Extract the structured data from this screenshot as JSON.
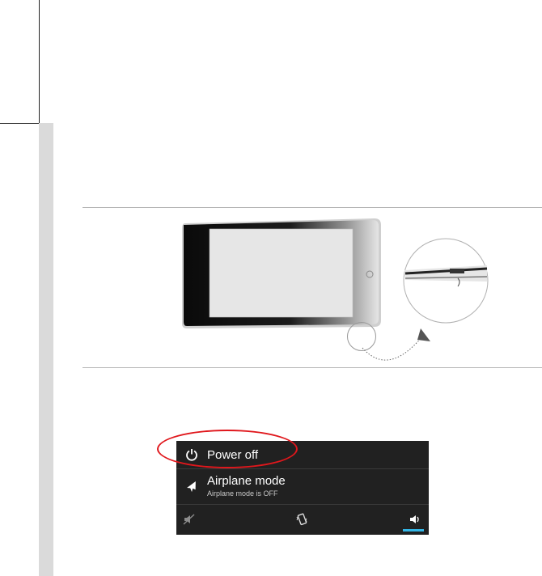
{
  "power_menu": {
    "power_off_label": "Power off",
    "airplane_label": "Airplane mode",
    "airplane_status": "Airplane mode is OFF",
    "power_icon": "power-icon",
    "airplane_icon": "airplane-icon",
    "sound_modes": [
      "silent-icon",
      "vibrate-icon",
      "sound-on-icon"
    ],
    "active_sound_mode": "sound-on-icon",
    "accent_color": "#33b5e5",
    "background_color": "#212121"
  },
  "highlight": {
    "color": "#e0171c"
  }
}
